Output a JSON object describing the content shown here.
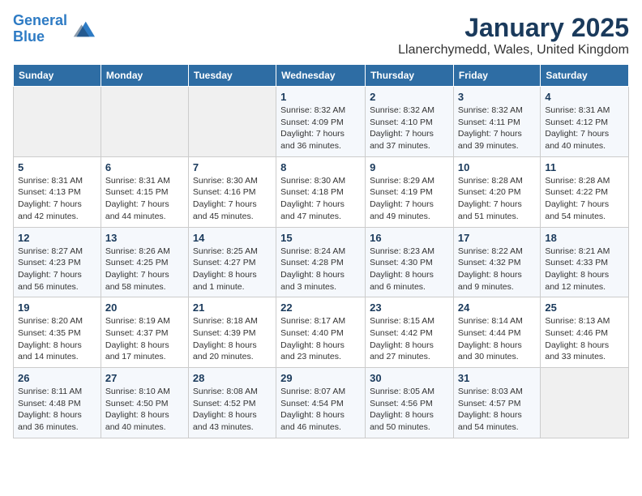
{
  "header": {
    "logo_line1": "General",
    "logo_line2": "Blue",
    "title": "January 2025",
    "subtitle": "Llanerchymedd, Wales, United Kingdom"
  },
  "days_of_week": [
    "Sunday",
    "Monday",
    "Tuesday",
    "Wednesday",
    "Thursday",
    "Friday",
    "Saturday"
  ],
  "weeks": [
    [
      {
        "num": "",
        "info": ""
      },
      {
        "num": "",
        "info": ""
      },
      {
        "num": "",
        "info": ""
      },
      {
        "num": "1",
        "info": "Sunrise: 8:32 AM\nSunset: 4:09 PM\nDaylight: 7 hours and 36 minutes."
      },
      {
        "num": "2",
        "info": "Sunrise: 8:32 AM\nSunset: 4:10 PM\nDaylight: 7 hours and 37 minutes."
      },
      {
        "num": "3",
        "info": "Sunrise: 8:32 AM\nSunset: 4:11 PM\nDaylight: 7 hours and 39 minutes."
      },
      {
        "num": "4",
        "info": "Sunrise: 8:31 AM\nSunset: 4:12 PM\nDaylight: 7 hours and 40 minutes."
      }
    ],
    [
      {
        "num": "5",
        "info": "Sunrise: 8:31 AM\nSunset: 4:13 PM\nDaylight: 7 hours and 42 minutes."
      },
      {
        "num": "6",
        "info": "Sunrise: 8:31 AM\nSunset: 4:15 PM\nDaylight: 7 hours and 44 minutes."
      },
      {
        "num": "7",
        "info": "Sunrise: 8:30 AM\nSunset: 4:16 PM\nDaylight: 7 hours and 45 minutes."
      },
      {
        "num": "8",
        "info": "Sunrise: 8:30 AM\nSunset: 4:18 PM\nDaylight: 7 hours and 47 minutes."
      },
      {
        "num": "9",
        "info": "Sunrise: 8:29 AM\nSunset: 4:19 PM\nDaylight: 7 hours and 49 minutes."
      },
      {
        "num": "10",
        "info": "Sunrise: 8:28 AM\nSunset: 4:20 PM\nDaylight: 7 hours and 51 minutes."
      },
      {
        "num": "11",
        "info": "Sunrise: 8:28 AM\nSunset: 4:22 PM\nDaylight: 7 hours and 54 minutes."
      }
    ],
    [
      {
        "num": "12",
        "info": "Sunrise: 8:27 AM\nSunset: 4:23 PM\nDaylight: 7 hours and 56 minutes."
      },
      {
        "num": "13",
        "info": "Sunrise: 8:26 AM\nSunset: 4:25 PM\nDaylight: 7 hours and 58 minutes."
      },
      {
        "num": "14",
        "info": "Sunrise: 8:25 AM\nSunset: 4:27 PM\nDaylight: 8 hours and 1 minute."
      },
      {
        "num": "15",
        "info": "Sunrise: 8:24 AM\nSunset: 4:28 PM\nDaylight: 8 hours and 3 minutes."
      },
      {
        "num": "16",
        "info": "Sunrise: 8:23 AM\nSunset: 4:30 PM\nDaylight: 8 hours and 6 minutes."
      },
      {
        "num": "17",
        "info": "Sunrise: 8:22 AM\nSunset: 4:32 PM\nDaylight: 8 hours and 9 minutes."
      },
      {
        "num": "18",
        "info": "Sunrise: 8:21 AM\nSunset: 4:33 PM\nDaylight: 8 hours and 12 minutes."
      }
    ],
    [
      {
        "num": "19",
        "info": "Sunrise: 8:20 AM\nSunset: 4:35 PM\nDaylight: 8 hours and 14 minutes."
      },
      {
        "num": "20",
        "info": "Sunrise: 8:19 AM\nSunset: 4:37 PM\nDaylight: 8 hours and 17 minutes."
      },
      {
        "num": "21",
        "info": "Sunrise: 8:18 AM\nSunset: 4:39 PM\nDaylight: 8 hours and 20 minutes."
      },
      {
        "num": "22",
        "info": "Sunrise: 8:17 AM\nSunset: 4:40 PM\nDaylight: 8 hours and 23 minutes."
      },
      {
        "num": "23",
        "info": "Sunrise: 8:15 AM\nSunset: 4:42 PM\nDaylight: 8 hours and 27 minutes."
      },
      {
        "num": "24",
        "info": "Sunrise: 8:14 AM\nSunset: 4:44 PM\nDaylight: 8 hours and 30 minutes."
      },
      {
        "num": "25",
        "info": "Sunrise: 8:13 AM\nSunset: 4:46 PM\nDaylight: 8 hours and 33 minutes."
      }
    ],
    [
      {
        "num": "26",
        "info": "Sunrise: 8:11 AM\nSunset: 4:48 PM\nDaylight: 8 hours and 36 minutes."
      },
      {
        "num": "27",
        "info": "Sunrise: 8:10 AM\nSunset: 4:50 PM\nDaylight: 8 hours and 40 minutes."
      },
      {
        "num": "28",
        "info": "Sunrise: 8:08 AM\nSunset: 4:52 PM\nDaylight: 8 hours and 43 minutes."
      },
      {
        "num": "29",
        "info": "Sunrise: 8:07 AM\nSunset: 4:54 PM\nDaylight: 8 hours and 46 minutes."
      },
      {
        "num": "30",
        "info": "Sunrise: 8:05 AM\nSunset: 4:56 PM\nDaylight: 8 hours and 50 minutes."
      },
      {
        "num": "31",
        "info": "Sunrise: 8:03 AM\nSunset: 4:57 PM\nDaylight: 8 hours and 54 minutes."
      },
      {
        "num": "",
        "info": ""
      }
    ]
  ]
}
